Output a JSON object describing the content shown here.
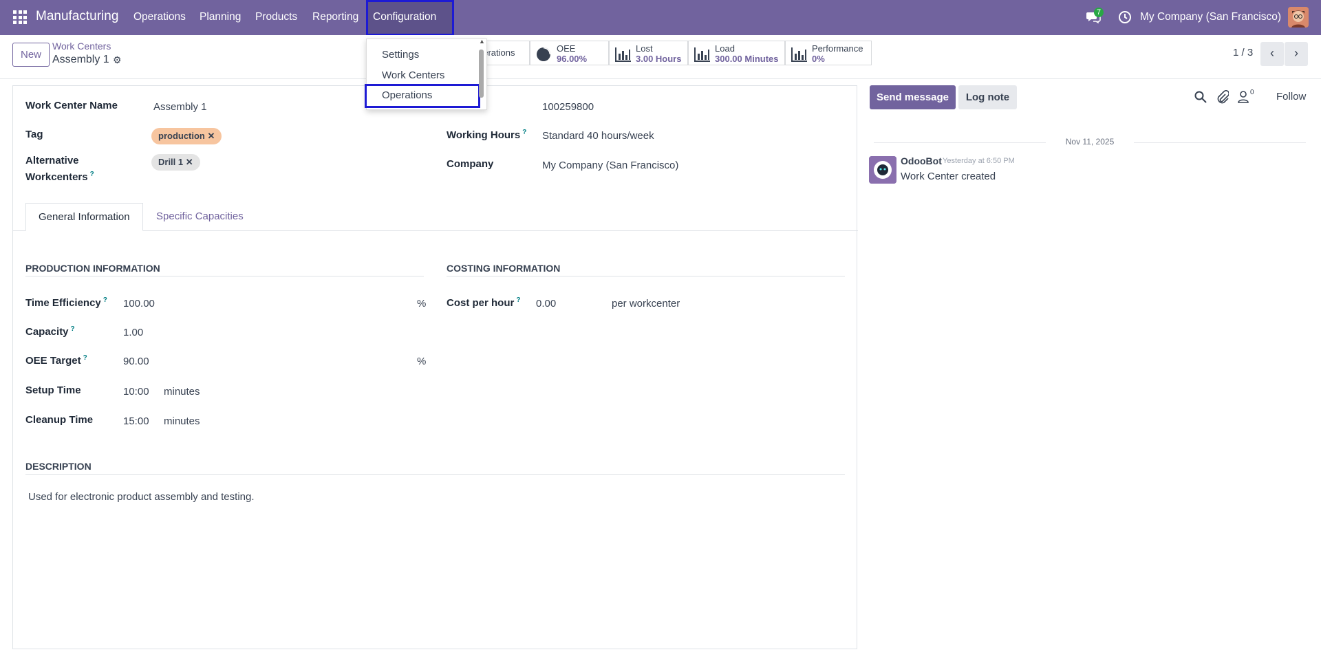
{
  "navbar": {
    "app_name": "Manufacturing",
    "menus": [
      "Operations",
      "Planning",
      "Products",
      "Reporting",
      "Configuration"
    ],
    "chat_count": "7",
    "company": "My Company (San Francisco)",
    "bg_color": "#71639e"
  },
  "control_panel": {
    "new_label": "New",
    "breadcrumb_parent": "Work Centers",
    "breadcrumb_current": "Assembly 1",
    "pager": "1 / 3",
    "stats": {
      "operations_label": "perations",
      "oee_label": "OEE",
      "oee_value": "96.00%",
      "lost_label": "Lost",
      "lost_value": "3.00 Hours",
      "load_label": "Load",
      "load_value": "300.00 Minutes",
      "performance_label": "Performance",
      "performance_value": "0%"
    }
  },
  "dropdown": {
    "items": [
      "Settings",
      "Work Centers",
      "Operations"
    ],
    "selected": "Operations"
  },
  "form": {
    "name_label": "Work Center Name",
    "name_value": "Assembly 1",
    "tag_label": "Tag",
    "tag_value": "production",
    "alt_label_1": "Alternative",
    "alt_label_2": "Workcenters",
    "alt_value": "Drill 1",
    "code_value": "100259800",
    "hours_label": "Working Hours",
    "hours_value": "Standard 40 hours/week",
    "company_label": "Company",
    "company_value": "My Company (San Francisco)",
    "tabs": [
      "General Information",
      "Specific Capacities"
    ],
    "production_title": "PRODUCTION INFORMATION",
    "costing_title": "COSTING INFORMATION",
    "time_eff_label": "Time Efficiency",
    "time_eff_value": "100.00",
    "percent": "%",
    "capacity_label": "Capacity",
    "capacity_value": "1.00",
    "oee_target_label": "OEE Target",
    "oee_target_value": "90.00",
    "setup_label": "Setup Time",
    "setup_value": "10:00",
    "minutes": "minutes",
    "cleanup_label": "Cleanup Time",
    "cleanup_value": "15:00",
    "cost_label": "Cost per hour",
    "cost_value": "0.00",
    "cost_unit": "per workcenter",
    "description_title": "DESCRIPTION",
    "description_value": "Used for electronic product assembly and testing."
  },
  "chatter": {
    "send_label": "Send message",
    "log_label": "Log note",
    "followers_count": "0",
    "follow_label": "Follow",
    "date": "Nov 11, 2025",
    "author": "OdooBot",
    "time": "Yesterday at 6:50 PM",
    "message": "Work Center created"
  }
}
